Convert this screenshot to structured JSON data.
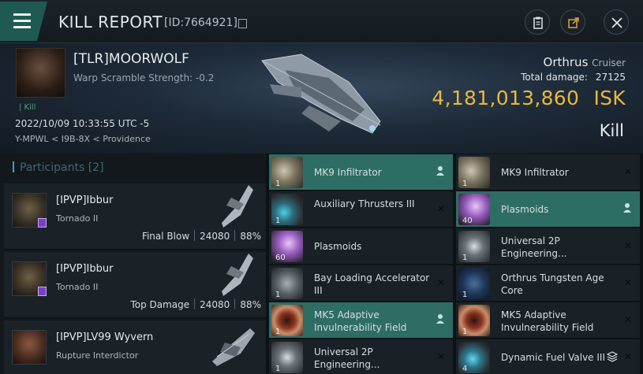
{
  "header": {
    "title": "KILL REPORT",
    "id_text": "[ID:7664921]"
  },
  "victim": {
    "name": "[TLR]MOORWOLF",
    "warp_scramble": "Warp Scramble Strength: -0.2",
    "kill_tag": "| Kill",
    "datetime": "2022/10/09 10:33:55 UTC -5",
    "location": "Y-MPWL < I9B-8X < Providence",
    "ship": "Orthrus",
    "ship_class": "Cruiser",
    "total_damage_label": "Total damage:",
    "total_damage": "27125",
    "isk_value": "4,181,013,860",
    "isk_unit": "ISK",
    "result": "Kill"
  },
  "participants": {
    "label": "Participants",
    "count": "[2]",
    "rows": [
      {
        "name": "[IPVP]Ibbur",
        "ship": "Tornado II",
        "role": "Final Blow",
        "damage": "24080",
        "percent": "88%"
      },
      {
        "name": "[IPVP]Ibbur",
        "ship": "Tornado II",
        "role": "Top Damage",
        "damage": "24080",
        "percent": "88%"
      },
      {
        "name": "[IPVP]LV99 Wyvern",
        "ship": "Rupture Interdictor"
      }
    ]
  },
  "items_left": [
    {
      "name": "MK9  Infiltrator",
      "qty": "1",
      "highlight": true,
      "mark": "person",
      "icon": "cloak-icon"
    },
    {
      "name": "Auxiliary Thrusters III",
      "qty": "1",
      "mark": "x",
      "icon": "thruster-icon"
    },
    {
      "name": "Plasmoids",
      "qty": "60",
      "mark": "none",
      "icon": "plasmoid-icon"
    },
    {
      "name": "Bay Loading Accelerator III",
      "qty": "1",
      "mark": "x",
      "icon": "rig-icon"
    },
    {
      "name": "MK5 Adaptive Invulnerability Field",
      "qty": "1",
      "highlight": true,
      "mark": "person",
      "icon": "shield-module-icon"
    },
    {
      "name": "Universal 2P Engineering...",
      "qty": "1",
      "mark": "x",
      "icon": "engineering-icon"
    }
  ],
  "items_right": [
    {
      "name": "MK9  Infiltrator",
      "qty": "1",
      "mark": "x",
      "icon": "cloak-icon"
    },
    {
      "name": "Plasmoids",
      "qty": "40",
      "highlight": true,
      "mark": "person",
      "icon": "plasmoid-icon"
    },
    {
      "name": "Universal 2P Engineering...",
      "qty": "1",
      "mark": "x",
      "icon": "engineering-icon"
    },
    {
      "name": "Orthrus Tungsten Age Core",
      "qty": "1",
      "mark": "x",
      "icon": "core-icon"
    },
    {
      "name": "MK5 Adaptive Invulnerability Field",
      "qty": "1",
      "mark": "x",
      "icon": "shield-module-icon"
    },
    {
      "name": "Dynamic Fuel Valve III",
      "qty": "4",
      "mark": "x",
      "stack": true,
      "icon": "fuel-valve-icon"
    }
  ],
  "colors": {
    "accent": "#2e6d64",
    "isk": "#e8b83f",
    "kill_green": "#4fa06e",
    "participants_header": "#3d6a72"
  }
}
